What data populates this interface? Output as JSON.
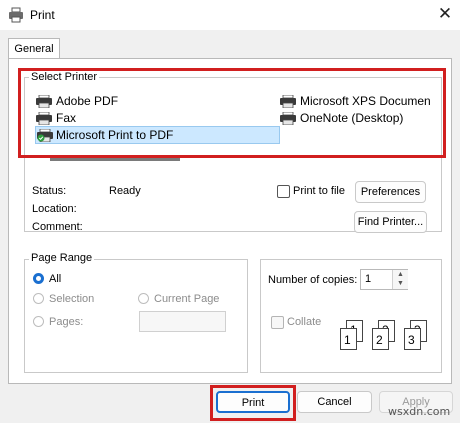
{
  "window": {
    "title": "Print",
    "close_icon": "close-icon"
  },
  "tabs": [
    {
      "label": "General"
    }
  ],
  "select_printer": {
    "label": "Select Printer",
    "printers": [
      {
        "name": "Adobe PDF",
        "icon": "printer-icon"
      },
      {
        "name": "Fax",
        "icon": "printer-icon"
      },
      {
        "name": "Microsoft Print to PDF",
        "icon": "default-printer-icon",
        "selected": true
      },
      {
        "name": "Microsoft XPS Documen",
        "icon": "printer-icon"
      },
      {
        "name": "OneNote (Desktop)",
        "icon": "printer-icon"
      }
    ],
    "highlight_color": "#d11f1f"
  },
  "printer_info": {
    "status_label": "Status:",
    "status_value": "Ready",
    "location_label": "Location:",
    "comment_label": "Comment:",
    "print_to_file_label": "Print to file",
    "preferences_label": "Preferences",
    "find_printer_label": "Find Printer..."
  },
  "page_range": {
    "label": "Page Range",
    "options": {
      "all": "All",
      "selection": "Selection",
      "current_page": "Current Page",
      "pages": "Pages:"
    },
    "selected": "All"
  },
  "copies": {
    "label": "Number of copies:",
    "value": "1",
    "collate_label": "Collate",
    "collate_pages": [
      "1",
      "1",
      "2",
      "2",
      "3",
      "3"
    ]
  },
  "footer": {
    "print_label": "Print",
    "cancel_label": "Cancel",
    "apply_label": "Apply",
    "watermark": "wsxdn.com"
  }
}
